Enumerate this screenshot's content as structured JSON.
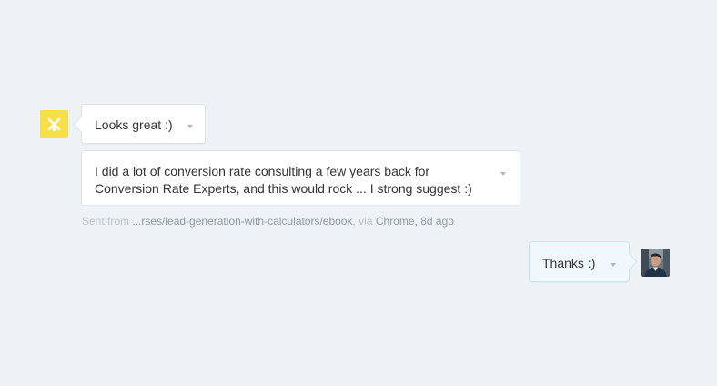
{
  "conversation": {
    "messages": [
      {
        "text": "Looks great :)",
        "author": "admin"
      },
      {
        "text": "I did a lot of conversion rate consulting a few years back for Conversion Rate Experts, and this would rock ... I strong suggest :)",
        "author": "admin"
      },
      {
        "text": "Thanks :)",
        "author": "user"
      }
    ],
    "meta": {
      "prefix": "Sent from ",
      "url": "...rses/lead-generation-with-calculators/ebook",
      "mid": ", via ",
      "browser": "Chrome",
      "sep": ", ",
      "time": "8d ago"
    }
  },
  "icons": {
    "admin_avatar": "windmill-logo-icon",
    "user_avatar": "user-photo-avatar",
    "menu": "chevron-down-icon"
  },
  "colors": {
    "background": "#eef2f5",
    "logo_bg": "#f7df4a",
    "user_bubble": "#f0f8fd",
    "user_bubble_border": "#c9e4f4"
  }
}
